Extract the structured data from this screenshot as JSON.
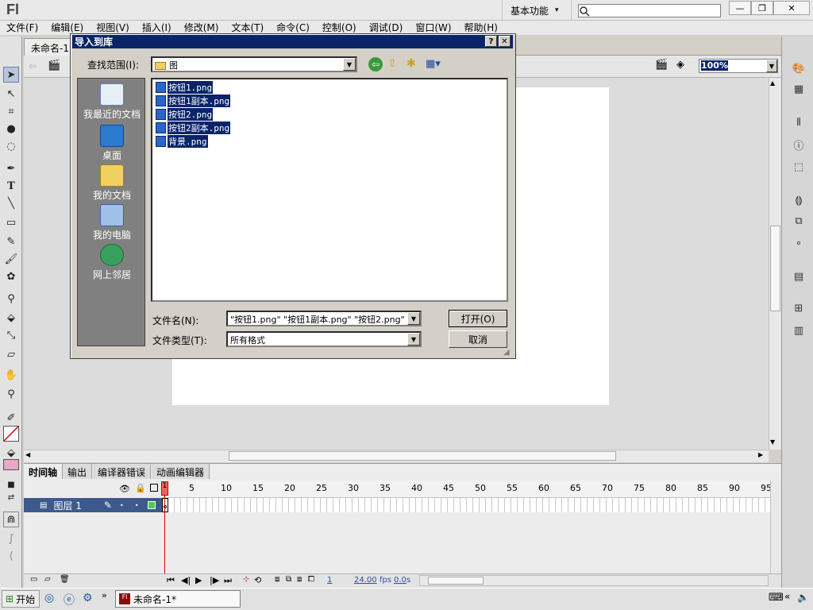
{
  "app": {
    "logo": "Fl",
    "workspace": "基本功能",
    "window_controls": [
      "minimize-icon",
      "restore-icon",
      "close-icon"
    ]
  },
  "menu": [
    "文件(F)",
    "编辑(E)",
    "视图(V)",
    "插入(I)",
    "修改(M)",
    "文本(T)",
    "命令(C)",
    "控制(O)",
    "调试(D)",
    "窗口(W)",
    "帮助(H)"
  ],
  "document": {
    "tab_label": "未命名-1",
    "zoom": "100%"
  },
  "dialog": {
    "title": "导入到库",
    "help_btn": "?",
    "close_btn": "✕",
    "lookin_label": "查找范围(I):",
    "lookin_value": "图",
    "places": [
      "我最近的文档",
      "桌面",
      "我的文档",
      "我的电脑",
      "网上邻居"
    ],
    "files": [
      "按钮1.png",
      "按钮1副本.png",
      "按钮2.png",
      "按钮2副本.png",
      "背景.png"
    ],
    "filename_label": "文件名(N):",
    "filename_value": "\"按钮1.png\" \"按钮1副本.png\" \"按钮2.png\"",
    "filetype_label": "文件类型(T):",
    "filetype_value": "所有格式",
    "open_btn": "打开(O)",
    "cancel_btn": "取消"
  },
  "timeline": {
    "tabs": [
      "时间轴",
      "输出",
      "编译器错误",
      "动画编辑器"
    ],
    "ruler": [
      "1",
      "5",
      "10",
      "15",
      "20",
      "25",
      "30",
      "35",
      "40",
      "45",
      "50",
      "55",
      "60",
      "65",
      "70",
      "75",
      "80",
      "85",
      "90",
      "95"
    ],
    "layer_name": "图层 1",
    "current_frame": "1",
    "fps": "24.00",
    "fps_unit": "fps",
    "time": "0.0",
    "time_unit": "s"
  },
  "taskbar": {
    "start": "开始",
    "task_item": "未命名-1*"
  }
}
